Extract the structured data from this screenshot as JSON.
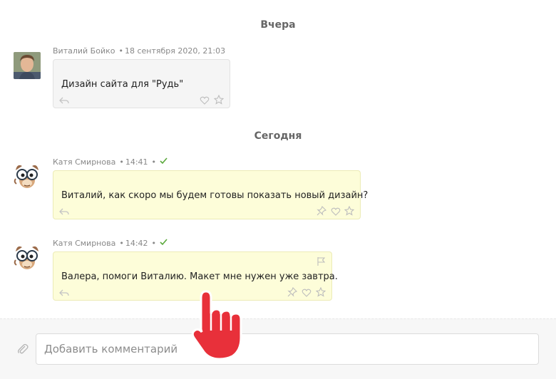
{
  "days": [
    {
      "label": "Вчера"
    },
    {
      "label": "Сегодня"
    }
  ],
  "messages": [
    {
      "author": "Виталий Бойко",
      "time": "18 сентября 2020, 21:03",
      "text": "Дизайн сайта для \"Рудь\"",
      "read": false,
      "style": "grey"
    },
    {
      "author": "Катя Смирнова",
      "time": "14:41",
      "text": "Виталий, как скоро мы будем готовы показать новый дизайн?",
      "read": true,
      "style": "yellow"
    },
    {
      "author": "Катя Смирнова",
      "time": "14:42",
      "text": "Валера, помоги Виталию. Макет мне нужен уже завтра.",
      "read": true,
      "style": "yellow"
    }
  ],
  "separator": "•",
  "composer": {
    "placeholder": "Добавить комментарий"
  },
  "icons": {
    "reply": "reply-icon",
    "like": "heart-icon",
    "favorite": "star-icon",
    "pin": "pin-icon",
    "flag": "flag-icon",
    "attach": "paperclip-icon",
    "read": "checkmark-icon",
    "cursor": "hand-pointer-icon"
  },
  "colors": {
    "check": "#5aa83b",
    "yellow_bubble": "#fdfdd9",
    "grey_bubble": "#f5f5f5",
    "cursor": "#e8303a"
  }
}
